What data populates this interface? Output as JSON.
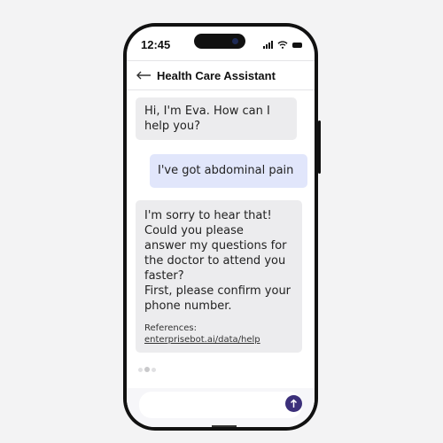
{
  "status_bar": {
    "time": "12:45",
    "icons": [
      "signal-icon",
      "wifi-icon",
      "battery-icon"
    ]
  },
  "header": {
    "back_icon": "arrow-left-icon",
    "title": "Health Care Assistant"
  },
  "messages": [
    {
      "sender": "bot",
      "lines": [
        "Hi, I'm Eva. How can I",
        "help you?"
      ]
    },
    {
      "sender": "user",
      "text": "I've got abdominal pain"
    },
    {
      "sender": "bot",
      "lines": [
        "I'm sorry to hear that!",
        "Could you please",
        "answer my questions for",
        "the doctor to attend you",
        "faster?",
        "First, please confirm your",
        "phone number."
      ],
      "references_label": "References:",
      "reference_link": "enterprisebot.ai/data/help"
    }
  ],
  "typing_indicator": "typing-dots",
  "composer": {
    "placeholder": "",
    "value": "",
    "send_icon": "arrow-up-icon"
  },
  "colors": {
    "bot_bubble": "#ececee",
    "user_bubble": "#e1e6fb",
    "send_button": "#3b2f7a"
  }
}
